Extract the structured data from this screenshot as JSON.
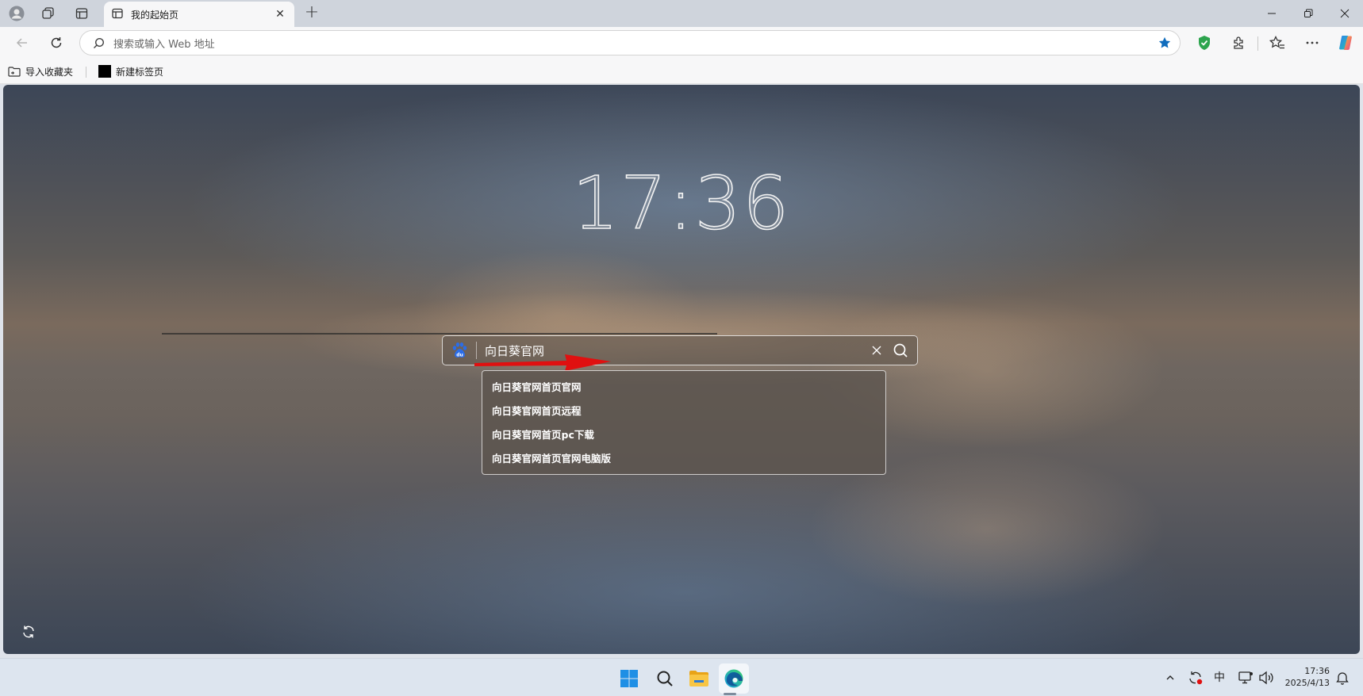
{
  "browser": {
    "tab": {
      "title": "我的起始页",
      "icon": "page-icon",
      "close_icon": "close-icon"
    },
    "new_tab_icon": "plus-icon",
    "window_controls": [
      "minimize-icon",
      "restore-icon",
      "close-icon"
    ],
    "address_bar": {
      "placeholder": "搜索或输入 Web 地址",
      "value": ""
    },
    "toolbar_icons": [
      "back-icon",
      "refresh-icon",
      "favorite-star-icon",
      "shield-icon",
      "extensions-icon",
      "favorites-icon",
      "more-icon",
      "copilot-icon"
    ]
  },
  "favorites_bar": {
    "items": [
      {
        "label": "导入收藏夹",
        "icon": "import-folder-icon"
      },
      {
        "label": "新建标签页",
        "icon": "black-square-icon"
      }
    ]
  },
  "page": {
    "clock": "17:36",
    "search": {
      "engine_icon": "baidu-paw-icon",
      "value": "向日葵官网",
      "suggestions": [
        "向日葵官网首页官网",
        "向日葵官网首页远程",
        "向日葵官网首页pc下载",
        "向日葵官网首页官网电脑版"
      ]
    },
    "annotation": "red-arrow",
    "refresh_background_icon": "refresh-icon"
  },
  "taskbar": {
    "apps": [
      "windows-start-icon",
      "search-icon",
      "file-explorer-icon",
      "edge-icon"
    ],
    "tray": {
      "ime": "中",
      "time": "17:36",
      "date": "2025/4/13"
    }
  },
  "colors": {
    "accent_blue": "#0f6cbd",
    "shield_green": "#2da44e",
    "arrow_red": "#e01010"
  }
}
